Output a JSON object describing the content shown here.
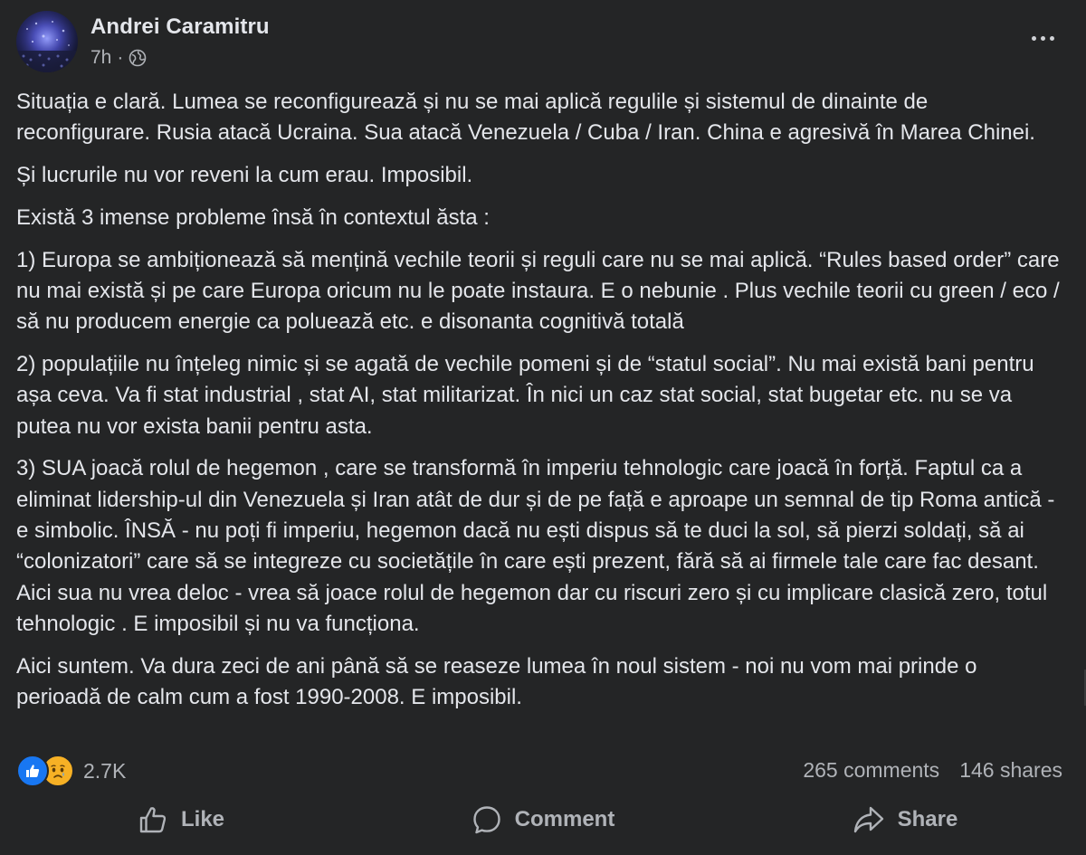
{
  "post": {
    "author": "Andrei Caramitru",
    "time": "7h",
    "privacy_icon": "globe-icon",
    "paragraphs": [
      "Situația e clară. Lumea se reconfigurează și nu se mai aplică regulile și sistemul de dinainte de reconfigurare. Rusia atacă Ucraina. Sua atacă Venezuela / Cuba / Iran. China e agresivă în Marea Chinei.",
      "Și lucrurile nu vor reveni la cum erau. Imposibil.",
      "Există 3 imense probleme însă în contextul ăsta :",
      "1) Europa se ambiționează să mențină vechile teorii și reguli care nu se mai aplică. “Rules based order” care nu mai există și pe care Europa oricum nu le poate instaura. E o nebunie . Plus vechile teorii cu green / eco / să nu producem energie ca poluează etc. e disonanta cognitivă totală",
      "2) populațiile nu înțeleg nimic și se agată de vechile pomeni și de “statul social”. Nu mai există bani pentru așa ceva. Va fi stat industrial , stat AI, stat militarizat. În nici un caz stat social, stat bugetar etc. nu se va putea nu vor exista banii pentru asta.",
      "3) SUA joacă rolul de hegemon , care se transformă în imperiu tehnologic care joacă în forță. Faptul ca a eliminat lidership-ul din Venezuela și Iran atât de dur și de pe față e aproape un semnal de tip Roma antică - e simbolic. ÎNSĂ - nu poți fi imperiu, hegemon dacă nu ești dispus să te duci la sol, să pierzi soldați, să ai “colonizatori” care să se integreze cu societățile în care ești prezent, fără să ai firmele tale care fac desant. Aici sua nu vrea deloc - vrea să joace rolul de hegemon dar cu riscuri zero și cu implicare clasică zero, totul tehnologic . E imposibil și nu va funcționa.",
      "Aici suntem. Va dura zeci de ani până să se reaseze lumea în noul sistem - noi nu vom mai prinde o perioadă de calm cum a fost 1990-2008. E imposibil."
    ]
  },
  "stats": {
    "reaction_icons": [
      "like-icon",
      "sad-icon"
    ],
    "reactions_count": "2.7K",
    "comments": "265 comments",
    "shares": "146 shares"
  },
  "actions": {
    "like": "Like",
    "comment": "Comment",
    "share": "Share"
  },
  "colors": {
    "background": "#242526",
    "text": "#e4e6eb",
    "secondary_text": "#b0b3b8",
    "like_blue": "#1877f2",
    "sad_yellow": "#f7b125"
  }
}
